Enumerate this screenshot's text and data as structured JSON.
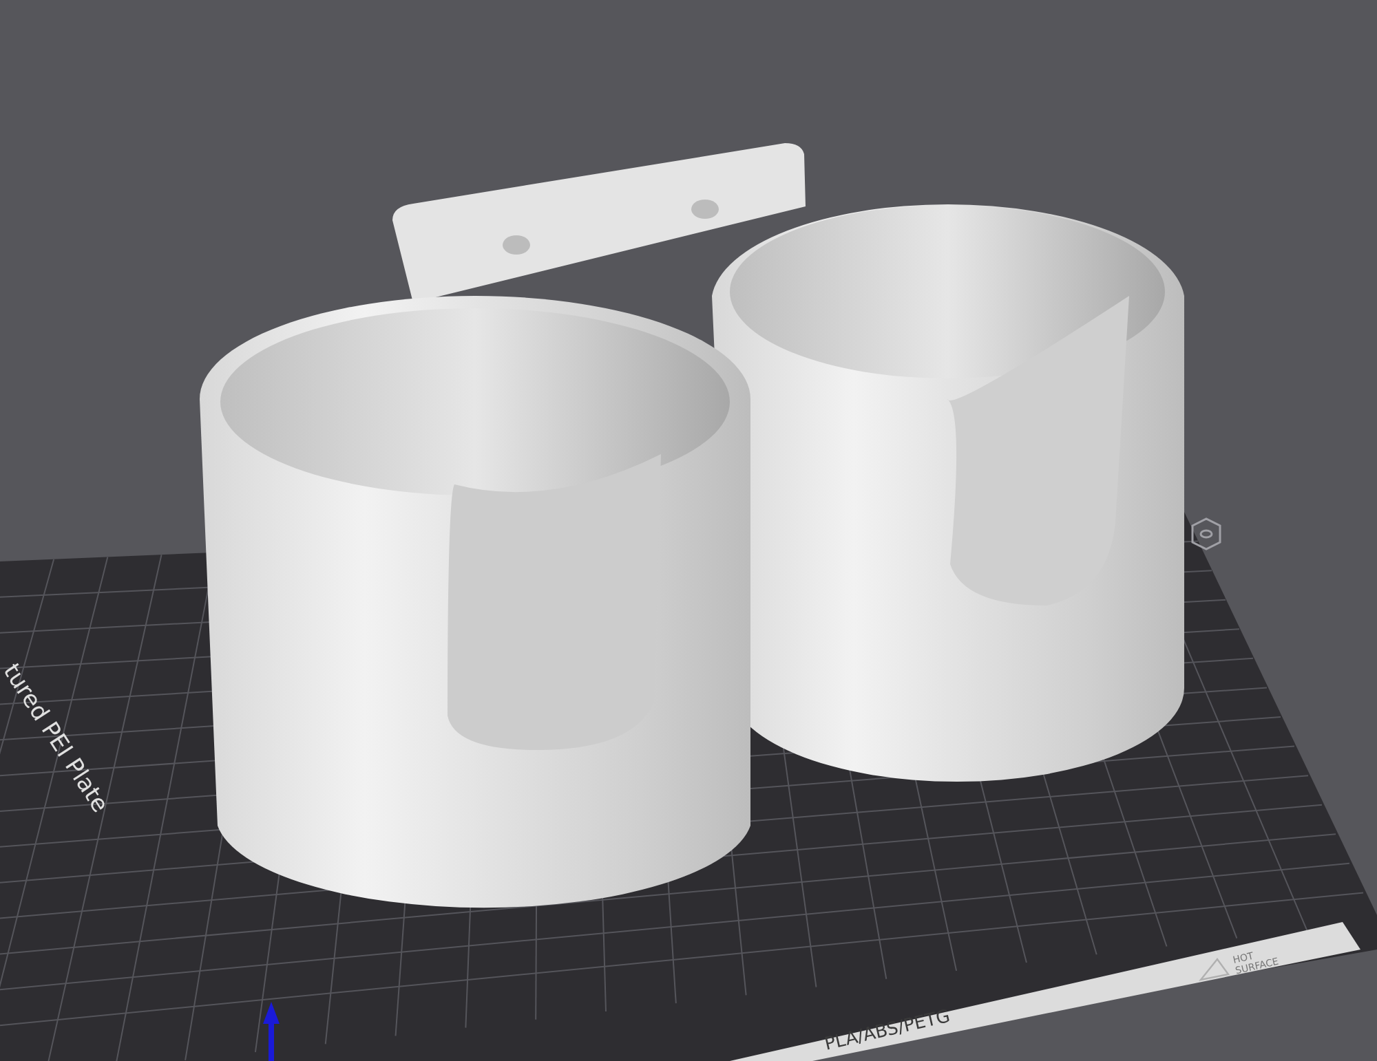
{
  "viewport": {
    "plate": {
      "label": "tured PEI Plate",
      "strip_text": "PLA/ABS/PETG",
      "warning": [
        "HOT",
        "SURFACE"
      ]
    }
  }
}
